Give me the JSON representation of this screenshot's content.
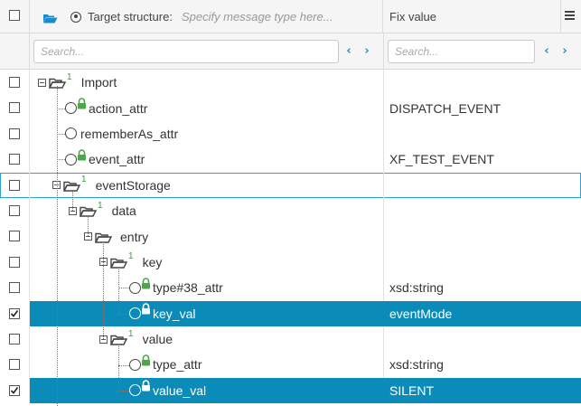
{
  "header": {
    "target_label": "Target structure:",
    "target_placeholder": "Specify message type here...",
    "fix_label": "Fix value"
  },
  "filter": {
    "left_placeholder": "Search...",
    "right_placeholder": "Search..."
  },
  "icons": {
    "folder_blue": "#1c8bc9",
    "lock_green": "#4aa84a",
    "selection": "#0b8bb7"
  },
  "rows": [
    {
      "label": "Import",
      "sup": "1",
      "type": "folder",
      "fix": "",
      "checked": false
    },
    {
      "label": "action_attr",
      "type": "attr",
      "lock": "green",
      "fix": "DISPATCH_EVENT",
      "checked": false
    },
    {
      "label": "rememberAs_attr",
      "type": "attr",
      "lock": "none",
      "fix": "",
      "checked": false
    },
    {
      "label": "event_attr",
      "type": "attr",
      "lock": "green",
      "fix": "XF_TEST_EVENT",
      "checked": false
    },
    {
      "label": "eventStorage",
      "sup": "1",
      "type": "folder",
      "fix": "",
      "checked": false
    },
    {
      "label": "data",
      "sup": "1",
      "type": "folder",
      "fix": "",
      "checked": false
    },
    {
      "label": "entry",
      "sup": "",
      "type": "folder",
      "fix": "",
      "checked": false
    },
    {
      "label": "key",
      "sup": "1",
      "type": "folder",
      "fix": "",
      "checked": false
    },
    {
      "label": "type#38_attr",
      "type": "attr",
      "lock": "green",
      "fix": "xsd:string",
      "checked": false
    },
    {
      "label": "key_val",
      "type": "attr",
      "lock": "white",
      "fix": "eventMode",
      "checked": true
    },
    {
      "label": "value",
      "sup": "1",
      "type": "folder",
      "fix": "",
      "checked": false
    },
    {
      "label": "type_attr",
      "type": "attr",
      "lock": "green",
      "fix": "xsd:string",
      "checked": false
    },
    {
      "label": "value_val",
      "type": "attr",
      "lock": "white",
      "fix": "SILENT",
      "checked": true
    }
  ]
}
